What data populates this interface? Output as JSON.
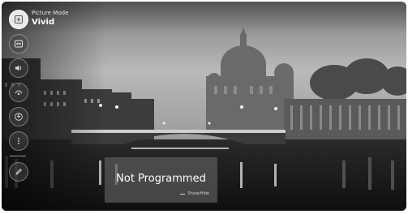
{
  "picture_mode": {
    "label": "Picture Mode",
    "value": "Vivid"
  },
  "side_menu": [
    {
      "icon": "picture-mode-icon",
      "active": true
    },
    {
      "icon": "picture-settings-icon",
      "active": false
    },
    {
      "icon": "sound-icon",
      "active": false
    },
    {
      "icon": "connection-icon",
      "active": false
    },
    {
      "icon": "accessibility-icon",
      "active": false
    },
    {
      "icon": "more-options-icon",
      "active": false
    },
    {
      "icon": "edit-icon",
      "active": false
    }
  ],
  "channel_panel": {
    "title": "Not Programmed",
    "hint": "Show/Hide"
  }
}
